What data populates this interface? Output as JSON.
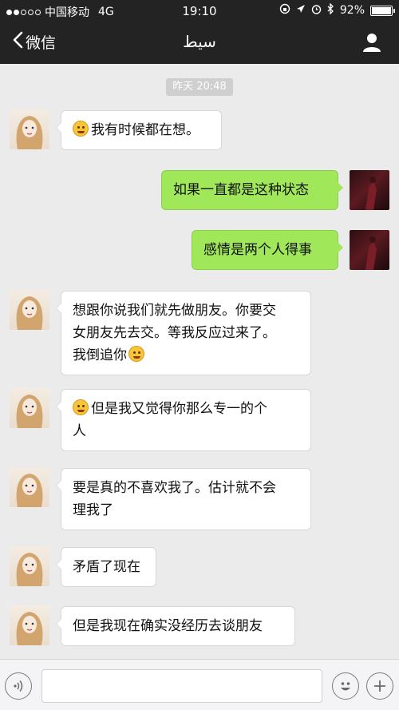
{
  "status_bar": {
    "carrier": "中国移动",
    "network": "4G",
    "time": "19:10",
    "battery_text": "92%",
    "battery_level": 0.92
  },
  "nav": {
    "back_label": "微信",
    "title": "سيط"
  },
  "chat": {
    "timestamp": "昨天 20:48",
    "messages": [
      {
        "from": "contact",
        "emoji": true,
        "text": "我有时候都在想。"
      },
      {
        "from": "me",
        "text": "如果一直都是这种状态"
      },
      {
        "from": "me",
        "text": "感情是两个人得事"
      },
      {
        "from": "contact",
        "line1": "想跟你说我们就先做朋友。你要交",
        "line2": "女朋友先去交。等我反应过来了。",
        "line3": "我倒追你",
        "trailing_emoji": true
      },
      {
        "from": "contact",
        "emoji": true,
        "line1": "但是我又觉得你那么专一的个",
        "line2": "人"
      },
      {
        "from": "contact",
        "line1": "要是真的不喜欢我了。估计就不会",
        "line2": "理我了"
      },
      {
        "from": "contact",
        "text": "矛盾了现在"
      },
      {
        "from": "contact",
        "text": "但是我现在确实没经历去谈朋友"
      }
    ]
  },
  "icons": {
    "back": "chevron-left-icon",
    "profile": "person-icon",
    "voice": "voice-icon",
    "emoji": "emoji-icon",
    "more": "plus-icon"
  },
  "colors": {
    "nav_bg": "#232323",
    "chat_bg": "#ebebeb",
    "outgoing_bubble": "#a0e75a",
    "incoming_bubble": "#ffffff"
  }
}
